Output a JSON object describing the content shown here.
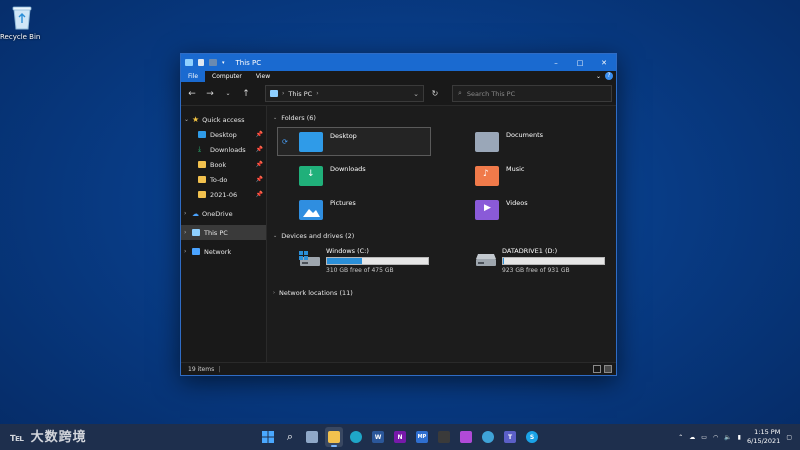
{
  "desktop": {
    "recycle_bin_label": "Recycle Bin"
  },
  "window": {
    "title": "This PC",
    "controls": {
      "minimize": "–",
      "maximize": "□",
      "close": "✕"
    },
    "ribbon_tabs": [
      "File",
      "Computer",
      "View"
    ],
    "address": {
      "location": "This PC"
    },
    "search": {
      "placeholder": "Search This PC"
    }
  },
  "sidebar": {
    "quick_access": "Quick access",
    "pinned": [
      {
        "label": "Desktop",
        "color": "#2f9be8"
      },
      {
        "label": "Downloads",
        "color": "#2bb673"
      },
      {
        "label": "Book",
        "color": "#f2c14e"
      },
      {
        "label": "To-do",
        "color": "#f2c14e"
      },
      {
        "label": "2021-06",
        "color": "#f2c14e"
      }
    ],
    "onedrive": "OneDrive",
    "this_pc": "This PC",
    "network": "Network"
  },
  "content": {
    "folders_header": "Folders (6)",
    "folders": [
      {
        "name": "Desktop",
        "color": "#2f9be8"
      },
      {
        "name": "Documents",
        "color": "#9aa7b8"
      },
      {
        "name": "Downloads",
        "color": "#20b07a"
      },
      {
        "name": "Music",
        "color": "#f07a4a"
      },
      {
        "name": "Pictures",
        "color": "#2f8ee0"
      },
      {
        "name": "Videos",
        "color": "#8a5ad8"
      }
    ],
    "drives_header": "Devices and drives (2)",
    "drives": [
      {
        "name": "Windows (C:)",
        "free": "310 GB free of 475 GB",
        "used_fraction": 0.347
      },
      {
        "name": "DATADRIVE1 (D:)",
        "free": "923 GB free of 931 GB",
        "used_fraction": 0.009
      }
    ],
    "network_header": "Network locations (11)"
  },
  "status": {
    "items": "19 items"
  },
  "taskbar": {
    "time": "1:15 PM",
    "date": "6/15/2021",
    "watermark": "大数跨境"
  },
  "colors": {
    "accent": "#1a6ad0",
    "window_bg": "#202020",
    "drive_fill": "#2a8fd8"
  }
}
